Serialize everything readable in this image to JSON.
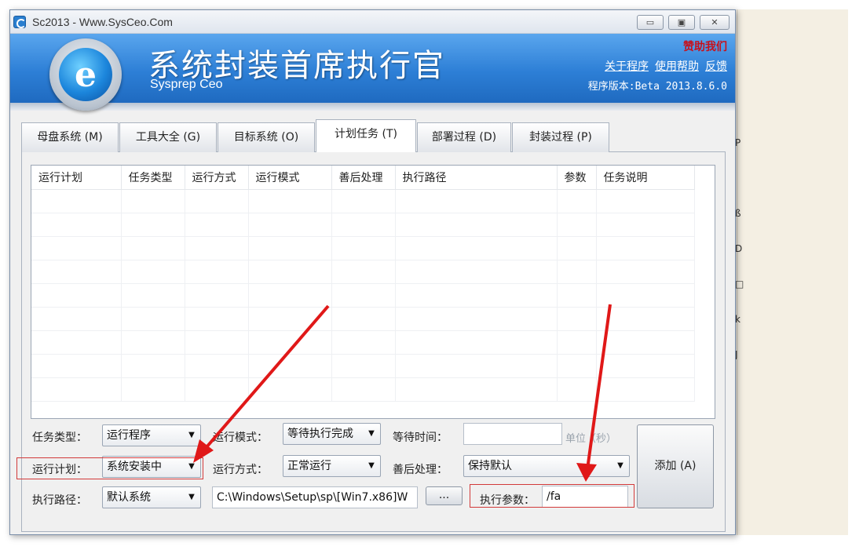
{
  "window": {
    "title": "Sc2013 - Www.SysCeo.Com",
    "minimize_glyph": "▭",
    "maximize_glyph": "▣",
    "close_glyph": "✕"
  },
  "banner": {
    "logo_letter": "e",
    "app_name": "系统封装首席执行官",
    "app_sub": "Sysprep  Ceo",
    "donate": "赞助我们",
    "links": [
      "关于程序",
      "使用帮助",
      "反馈"
    ],
    "version": "程序版本:Beta 2013.8.6.0"
  },
  "tabs": [
    {
      "label": "母盘系统 (M)"
    },
    {
      "label": "工具大全 (G)"
    },
    {
      "label": "目标系统 (O)"
    },
    {
      "label": "计划任务 (T)",
      "active": true
    },
    {
      "label": "部署过程 (D)"
    },
    {
      "label": "封装过程 (P)"
    }
  ],
  "grid": {
    "columns": [
      "运行计划",
      "任务类型",
      "运行方式",
      "运行模式",
      "善后处理",
      "执行路径",
      "参数",
      "任务说明"
    ],
    "rows": []
  },
  "form": {
    "task_type_label": "任务类型：",
    "task_type_value": "运行程序",
    "run_plan_label": "运行计划：",
    "run_plan_value": "系统安装中",
    "exec_path_label": "执行路径：",
    "exec_path_value": "默认系统",
    "run_mode_label": "运行模式：",
    "run_mode_value": "等待执行完成",
    "run_method_label": "运行方式：",
    "run_method_value": "正常运行",
    "path_text": "C:\\Windows\\Setup\\sp\\[Win7.x86]W",
    "browse_label": "...",
    "wait_time_label": "等待时间：",
    "wait_time_value": "",
    "unit_label": "单位（秒）",
    "aftercare_label": "善后处理：",
    "aftercare_value": "保持默认",
    "params_label": "执行参数：",
    "params_value": "/fa",
    "add_button": "添加 (A)"
  },
  "background_glyphs": [
    "P",
    "ß",
    "D",
    "□",
    "k",
    "J"
  ],
  "colors": {
    "banner_blue": "#2d7fd6",
    "highlight_red": "#d23a3a",
    "arrow_red": "#e01818"
  }
}
